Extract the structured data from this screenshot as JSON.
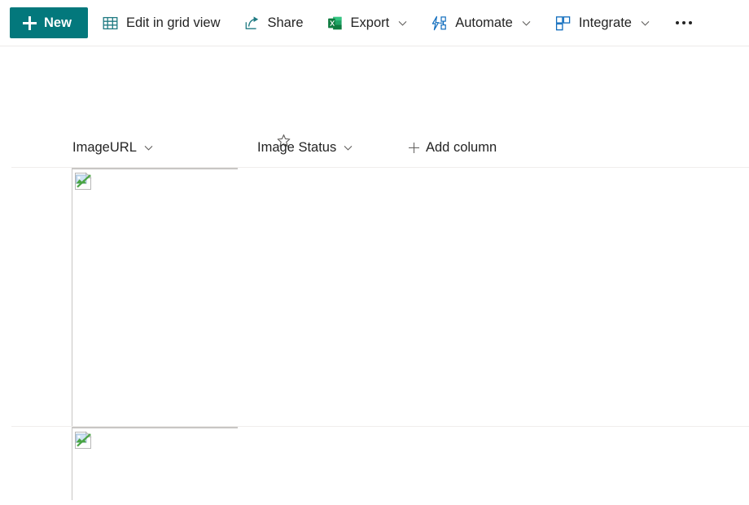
{
  "app": {
    "name": "SharePoint list view",
    "accent_color": "#03787c",
    "text_color": "#242424",
    "border_color": "#c8c6c4",
    "rule_color": "#f0eeec"
  },
  "toolbar": {
    "new_label": "New",
    "new_icon": "plus-icon",
    "items": [
      {
        "label": "Edit in grid view",
        "icon": "grid-view-icon",
        "has_chevron": false
      },
      {
        "label": "Share",
        "icon": "share-icon",
        "has_chevron": false
      },
      {
        "label": "Export",
        "icon": "excel-icon",
        "has_chevron": true
      },
      {
        "label": "Automate",
        "icon": "power-automate-icon",
        "has_chevron": true
      },
      {
        "label": "Integrate",
        "icon": "integrate-icon",
        "has_chevron": true
      }
    ],
    "overflow_label": "More options",
    "overflow_icon": "ellipsis-icon"
  },
  "list": {
    "favorite_icon": "star-outline-icon",
    "favorite_label": "Add to favorites",
    "columns": [
      {
        "name": "ImageURL",
        "label": "ImageURL",
        "sort_icon": "chevron-down-icon"
      },
      {
        "name": "Image Status",
        "label": "Image Status",
        "sort_icon": "chevron-down-icon"
      }
    ],
    "add_column_label": "Add column",
    "add_column_icon": "plus-icon",
    "rows": [
      {
        "image_url_value": "",
        "image_alt": "broken-image-placeholder",
        "image_status_value": ""
      },
      {
        "image_url_value": "",
        "image_alt": "broken-image-placeholder",
        "image_status_value": ""
      }
    ]
  }
}
